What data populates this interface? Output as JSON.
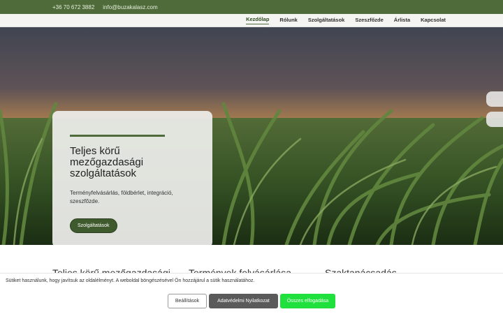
{
  "topbar": {
    "phone": "+36 70 672 3882",
    "email": "info@buzakalasz.com"
  },
  "nav": {
    "items": [
      "Kezdőlap",
      "Rólunk",
      "Szolgáltatások",
      "Szeszfőzde",
      "Árlista",
      "Kapcsolat"
    ]
  },
  "hero": {
    "title": "Teljes körű mezőgazdasági szolgáltatások",
    "subtitle": "Terményfelvásárlás, földbérlet, integráció, szeszfőzde.",
    "button": "Szolgáltatások"
  },
  "sections": [
    "Teljes körű mezőgazdasági",
    "Termények felvásárlása",
    "Szaktanácsadás"
  ],
  "cookie": {
    "message": "Sütiket használunk, hogy javítsuk az oldalélményt. A weboldal böngészésével Ön hozzájárul a sütik használatához.",
    "settings": "Beállítások",
    "privacy": "Adatvédelmi Nyilatkozat",
    "accept": "Összes elfogadása"
  },
  "colors": {
    "brand_green": "#4f6b3a",
    "accept_green": "#1fe03c"
  }
}
